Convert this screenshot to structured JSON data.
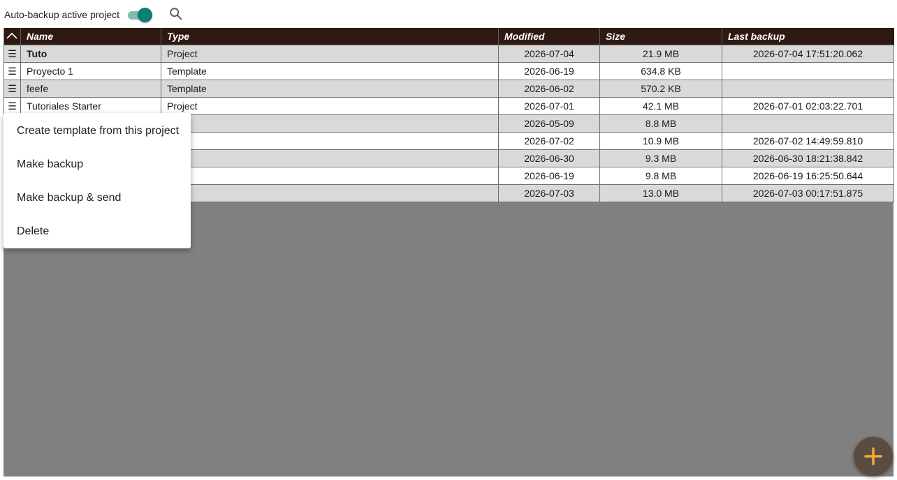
{
  "topbar": {
    "autobackup_label": "Auto-backup active project",
    "autobackup_enabled": true,
    "search_icon": "search-icon"
  },
  "table": {
    "columns": [
      "Name",
      "Type",
      "Modified",
      "Size",
      "Last backup"
    ],
    "sort_icon": "chevron-up-icon",
    "row_menu_icon": "hamburger-menu-icon",
    "rows": [
      {
        "name": "Tuto",
        "type": "Project",
        "modified": "2026-07-04",
        "size": "21.9 MB",
        "last_backup": "2026-07-04 17:51:20.062"
      },
      {
        "name": "Proyecto 1",
        "type": "Template",
        "modified": "2026-06-19",
        "size": "634.8 KB",
        "last_backup": ""
      },
      {
        "name": "feefe",
        "type": "Template",
        "modified": "2026-06-02",
        "size": "570.2 KB",
        "last_backup": ""
      },
      {
        "name": "Tutoriales Starter",
        "type": "Project",
        "modified": "2026-07-01",
        "size": "42.1 MB",
        "last_backup": "2026-07-01 02:03:22.701"
      },
      {
        "name": "",
        "type": "ct",
        "modified": "2026-05-09",
        "size": "8.8 MB",
        "last_backup": ""
      },
      {
        "name": "",
        "type": "ct",
        "modified": "2026-07-02",
        "size": "10.9 MB",
        "last_backup": "2026-07-02 14:49:59.810"
      },
      {
        "name": "",
        "type": "ct",
        "modified": "2026-06-30",
        "size": "9.3 MB",
        "last_backup": "2026-06-30 18:21:38.842"
      },
      {
        "name": "",
        "type": "ct",
        "modified": "2026-06-19",
        "size": "9.8 MB",
        "last_backup": "2026-06-19 16:25:50.644"
      },
      {
        "name": "",
        "type": "ct",
        "modified": "2026-07-03",
        "size": "13.0 MB",
        "last_backup": "2026-07-03 00:17:51.875"
      }
    ]
  },
  "context_menu": {
    "items": [
      "Create template from this project",
      "Make backup",
      "Make backup & send",
      "Delete"
    ]
  },
  "fab": {
    "icon": "plus-icon"
  },
  "colors": {
    "header_bg": "#2e1a12",
    "toggle_accent": "#0d7e72",
    "fab_bg": "#5b4c42",
    "fab_icon": "#f2a93b",
    "empty_area": "#808080"
  }
}
